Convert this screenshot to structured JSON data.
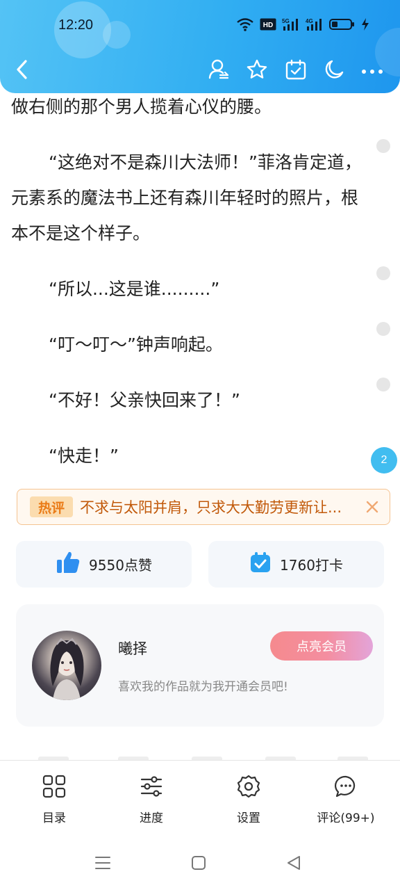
{
  "status_bar": {
    "time": "12:20",
    "hd_label": "HD",
    "net1_label": "5G",
    "net2_label": "4G"
  },
  "top_bar": {
    "background": "#31aef2",
    "icons": [
      "back-icon",
      "author-follow-icon",
      "favorite-star-icon",
      "calendar-check-icon",
      "night-mode-icon",
      "more-icon"
    ]
  },
  "reader": {
    "paragraphs": [
      "做右侧的那个男人揽着心仪的腰。",
      "“这绝对不是森川大法师！”菲洛肯定道，元素系的魔法书上还有森川年轻时的照片，根本不是这个样子。",
      "“所以...这是谁.........”",
      "“叮～叮～”钟声响起。",
      "“不好！父亲快回来了！”",
      "“快走！”"
    ],
    "paragraph_comment_count": "2"
  },
  "hot_comment": {
    "tag": "热评",
    "text": "不求与太阳并肩，只求大大勤劳更新让..."
  },
  "actions": {
    "like_label": "9550点赞",
    "checkin_label": "1760打卡"
  },
  "author": {
    "name": "曦择",
    "desc": "喜欢我的作品就为我开通会员吧!",
    "vip_button": "点亮会员"
  },
  "toolbar": {
    "items": [
      {
        "label": "目录",
        "icon": "catalog-grid-icon"
      },
      {
        "label": "进度",
        "icon": "progress-sliders-icon"
      },
      {
        "label": "设置",
        "icon": "settings-gear-icon"
      },
      {
        "label": "评论(99+)",
        "icon": "comment-bubble-icon"
      }
    ]
  },
  "colors": {
    "accent": "#41bdf0",
    "hot_text": "#c1590a",
    "vip_gradient_start": "#f58a8e",
    "vip_gradient_end": "#e3a4d9"
  }
}
